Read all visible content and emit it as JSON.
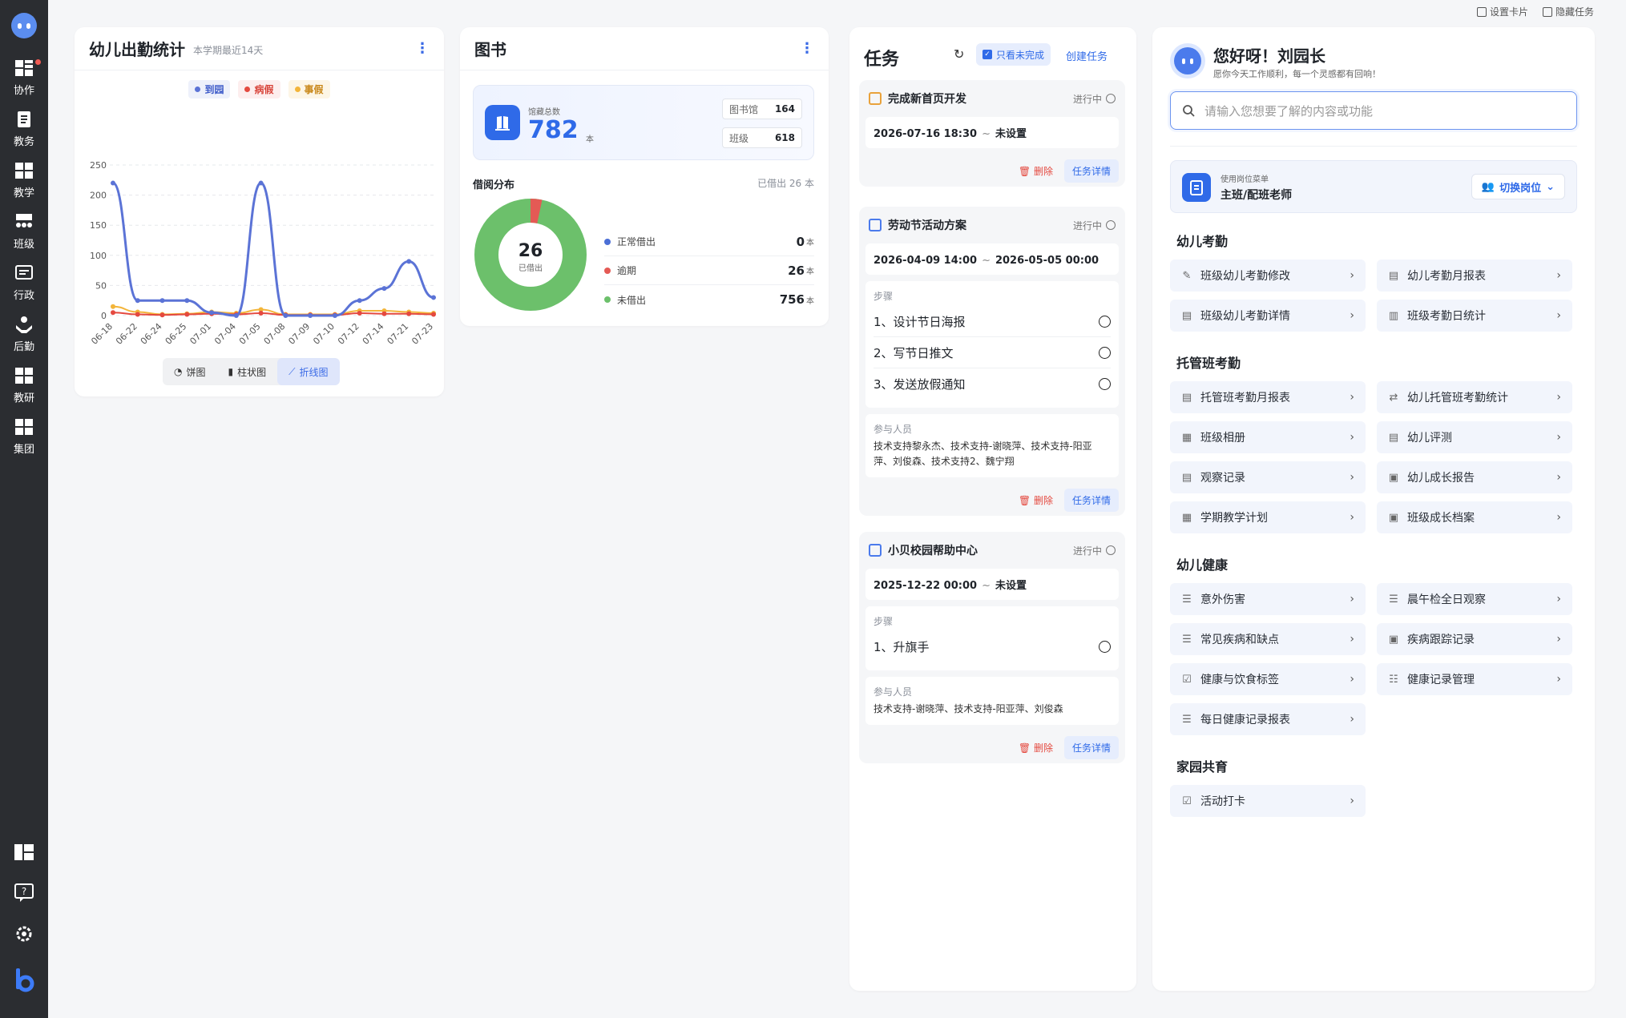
{
  "sidebar": {
    "items": [
      {
        "label": "协作",
        "icon": "grid-icon"
      },
      {
        "label": "教务",
        "icon": "clipboard-icon"
      },
      {
        "label": "教学",
        "icon": "grid-icon"
      },
      {
        "label": "班级",
        "icon": "people-icon"
      },
      {
        "label": "行政",
        "icon": "monitor-icon"
      },
      {
        "label": "后勤",
        "icon": "hand-icon"
      },
      {
        "label": "教研",
        "icon": "grid-icon"
      },
      {
        "label": "集团",
        "icon": "grid-icon"
      }
    ],
    "bottom_icons": [
      "layout-icon",
      "help-icon",
      "settings-icon",
      "brand-icon"
    ]
  },
  "topbar": {
    "settings_card": "设置卡片",
    "hide_tasks": "隐藏任务"
  },
  "attendance": {
    "title": "幼儿出勤统计",
    "subtitle": "本学期最近14天",
    "legend": [
      {
        "label": "到园",
        "color": "#5b73d6"
      },
      {
        "label": "病假",
        "color": "#e4493f"
      },
      {
        "label": "事假",
        "color": "#f3b53a"
      }
    ],
    "modes": {
      "pie": "饼图",
      "bar": "柱状图",
      "line": "折线图"
    }
  },
  "chart_data": {
    "type": "line",
    "categories": [
      "06-18",
      "06-22",
      "06-24",
      "06-25",
      "07-01",
      "07-04",
      "07-05",
      "07-08",
      "07-09",
      "07-10",
      "07-12",
      "07-14",
      "07-21",
      "07-23"
    ],
    "series": [
      {
        "name": "到园",
        "values": [
          220,
          25,
          25,
          25,
          5,
          0,
          220,
          0,
          0,
          0,
          25,
          45,
          90,
          30
        ]
      },
      {
        "name": "病假",
        "values": [
          5,
          2,
          1,
          2,
          3,
          2,
          4,
          1,
          1,
          1,
          4,
          3,
          3,
          2
        ]
      },
      {
        "name": "事假",
        "values": [
          15,
          6,
          2,
          3,
          6,
          4,
          10,
          2,
          2,
          2,
          8,
          8,
          6,
          4
        ]
      }
    ],
    "yticks": [
      0,
      50,
      100,
      150,
      200,
      250
    ],
    "ylim": [
      0,
      250
    ]
  },
  "books": {
    "title": "图书",
    "total_label": "馆藏总数",
    "total_value": "782",
    "total_unit": "本",
    "library_label": "图书馆",
    "library_value": "164",
    "class_label": "班级",
    "class_value": "618",
    "borrow_title": "借阅分布",
    "borrow_sub": "已借出 26 本",
    "donut_value": "26",
    "donut_label": "已借出",
    "unit": "本",
    "distribution": [
      {
        "label": "正常借出",
        "value": "0",
        "color": "#4b6fd6"
      },
      {
        "label": "逾期",
        "value": "26",
        "color": "#e45a55"
      },
      {
        "label": "未借出",
        "value": "756",
        "color": "#6cc06b"
      }
    ]
  },
  "tasks": {
    "title": "任务",
    "filter": "只看未完成",
    "create": "创建任务",
    "steps_label": "步骤",
    "people_label": "参与人员",
    "delete": "删除",
    "detail": "任务详情",
    "status": "进行中",
    "items": [
      {
        "title": "完成新首页开发",
        "start": "2026-07-16 18:30",
        "end": "未设置"
      },
      {
        "title": "劳动节活动方案",
        "start": "2026-04-09 14:00",
        "end": "2026-05-05 00:00",
        "steps": [
          "1、设计节日海报",
          "2、写节日推文",
          "3、发送放假通知"
        ],
        "people": "技术支持黎永杰、技术支持-谢晓萍、技术支持-阳亚萍、刘俊森、技术支持2、魏宁翔"
      },
      {
        "title": "小贝校园帮助中心",
        "start": "2025-12-22 00:00",
        "end": "未设置",
        "steps": [
          "1、升旗手"
        ],
        "people": "技术支持-谢晓萍、技术支持-阳亚萍、刘俊森"
      }
    ]
  },
  "panel": {
    "hello": "您好呀！刘园长",
    "wish": "愿你今天工作顺利，每一个灵感都有回响！",
    "search_placeholder": "请输入您想要了解的内容或功能",
    "role_label": "使用岗位菜单",
    "role_value": "主班/配班老师",
    "switch_role": "切换岗位",
    "sections": [
      {
        "title": "幼儿考勤",
        "items": [
          "班级幼儿考勤修改",
          "幼儿考勤月报表",
          "班级幼儿考勤详情",
          "班级考勤日统计"
        ]
      },
      {
        "title": "托管班考勤",
        "items": [
          "托管班考勤月报表",
          "幼儿托管班考勤统计",
          "班级相册",
          "幼儿评测",
          "观察记录",
          "幼儿成长报告",
          "学期教学计划",
          "班级成长档案"
        ]
      },
      {
        "title": "幼儿健康",
        "items": [
          "意外伤害",
          "晨午检全日观察",
          "常见疾病和缺点",
          "疾病跟踪记录",
          "健康与饮食标签",
          "健康记录管理",
          "每日健康记录报表"
        ]
      },
      {
        "title": "家园共育",
        "items": [
          "活动打卡"
        ]
      }
    ]
  }
}
